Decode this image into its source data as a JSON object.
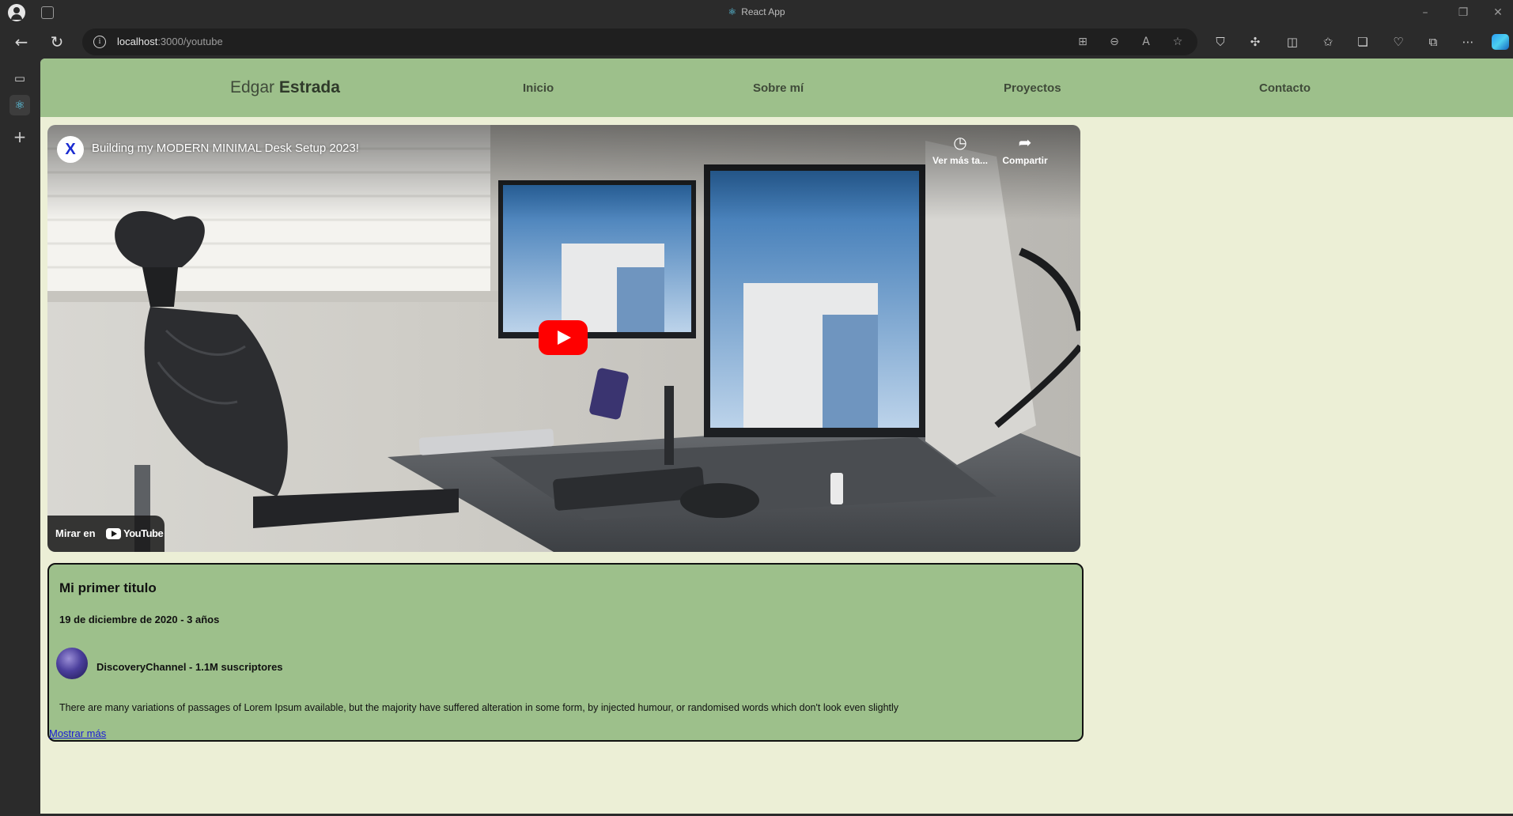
{
  "browser": {
    "tab_title": "React App",
    "url_host": "localhost",
    "url_rest": ":3000/youtube",
    "win_controls": [
      "–",
      "❐",
      "✕"
    ]
  },
  "site": {
    "brand_first": "Edgar",
    "brand_last": "Estrada",
    "nav": [
      "Inicio",
      "Sobre mí",
      "Proyectos",
      "Contacto"
    ]
  },
  "video": {
    "channel_logo": "X",
    "title": "Building my MODERN MINIMAL Desk Setup 2023!",
    "watch_later": "Ver más ta...",
    "share": "Compartir",
    "watch_on": "Mirar en",
    "youtube_wordmark": "YouTube"
  },
  "card": {
    "title": "Mi primer titulo",
    "date": "19 de diciembre de 2020 - 3 años",
    "channel": "DiscoveryChannel - 1.1M suscriptores",
    "description": "There are many variations of passages of Lorem Ipsum available, but the majority have suffered alteration in some form, by injected humour, or randomised words which don't look even slightly",
    "more": "Mostrar más"
  },
  "colors": {
    "nav_bg": "#9dc08b",
    "page_bg": "#ecefd6",
    "card_bg": "#9dc08b",
    "play_red": "#ff0000",
    "link": "#1a1ad6"
  }
}
